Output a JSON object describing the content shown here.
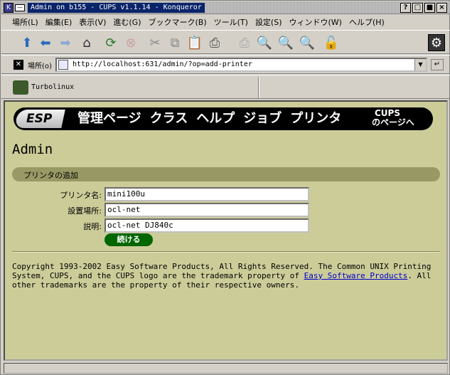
{
  "window": {
    "title": "Admin on b155 - CUPS v1.1.14 - Konqueror",
    "buttons": [
      "?",
      "□",
      "■",
      "×"
    ]
  },
  "menu": [
    "場所(L)",
    "編集(E)",
    "表示(V)",
    "進む(G)",
    "ブックマーク(B)",
    "ツール(T)",
    "設定(S)",
    "ウィンドウ(W)",
    "ヘルプ(H)"
  ],
  "location": {
    "label": "場所(o)",
    "url": "http://localhost:631/admin/?op=add-printer"
  },
  "bookmarks": {
    "item": "Turbolinux"
  },
  "cups_nav": {
    "logo": "ESP",
    "items": [
      "管理ページ",
      "クラス",
      "ヘルプ",
      "ジョブ",
      "プリンタ"
    ],
    "cups_line1": "CUPS",
    "cups_line2": "のページへ"
  },
  "page": {
    "heading": "Admin",
    "section": "プリンタの追加",
    "fields": [
      {
        "label": "プリンタ名:",
        "value": "mini100u"
      },
      {
        "label": "設置場所:",
        "value": "ocl-net"
      },
      {
        "label": "説明:",
        "value": "ocl-net DJ840c"
      }
    ],
    "submit": "続ける",
    "copyright_pre": "Copyright 1993-2002 Easy Software Products, All Rights Reserved. The Common UNIX Printing System, CUPS, and the CUPS logo are the trademark property of ",
    "copyright_link": "Easy Software Products",
    "copyright_post": ". All other trademarks are the property of their respective owners."
  },
  "icons": {
    "toolbar": [
      "up-arrow-icon",
      "back-arrow-icon",
      "forward-arrow-icon",
      "home-icon",
      "reload-icon",
      "stop-icon",
      "cut-icon",
      "copy-icon",
      "paste-icon",
      "print-icon",
      "print-disabled-icon",
      "zoom-in-icon",
      "zoom-out-icon",
      "zoom-disabled-icon",
      "security-lock-icon",
      "settings-gear-icon"
    ]
  }
}
